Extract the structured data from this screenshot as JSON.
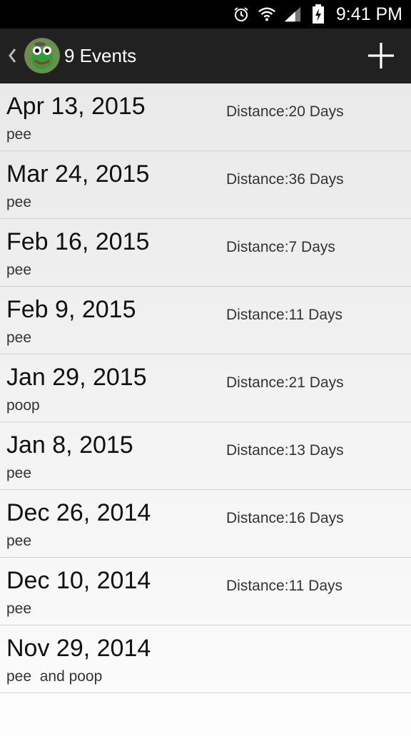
{
  "status_bar": {
    "time": "9:41 PM",
    "icons": [
      "alarm-icon",
      "wifi-icon",
      "signal-icon",
      "battery-charging-icon"
    ]
  },
  "action_bar": {
    "title": "9 Events",
    "up_icon": "back-chevron-icon",
    "app_icon": "frog-avatar-icon",
    "add_icon": "plus-icon"
  },
  "events": [
    {
      "date": "Apr 13, 2015",
      "type": "pee",
      "distance": "Distance:20 Days"
    },
    {
      "date": "Mar 24, 2015",
      "type": "pee",
      "distance": "Distance:36 Days"
    },
    {
      "date": "Feb 16, 2015",
      "type": "pee",
      "distance": "Distance:7 Days"
    },
    {
      "date": "Feb 9, 2015",
      "type": "pee",
      "distance": "Distance:11 Days"
    },
    {
      "date": "Jan 29, 2015",
      "type": "poop",
      "distance": "Distance:21 Days"
    },
    {
      "date": "Jan 8, 2015",
      "type": "pee",
      "distance": "Distance:13 Days"
    },
    {
      "date": "Dec 26, 2014",
      "type": "pee",
      "distance": "Distance:16 Days"
    },
    {
      "date": "Dec 10, 2014",
      "type": "pee",
      "distance": "Distance:11 Days"
    },
    {
      "date": "Nov 29, 2014",
      "type": "pee  and poop",
      "distance": ""
    }
  ]
}
